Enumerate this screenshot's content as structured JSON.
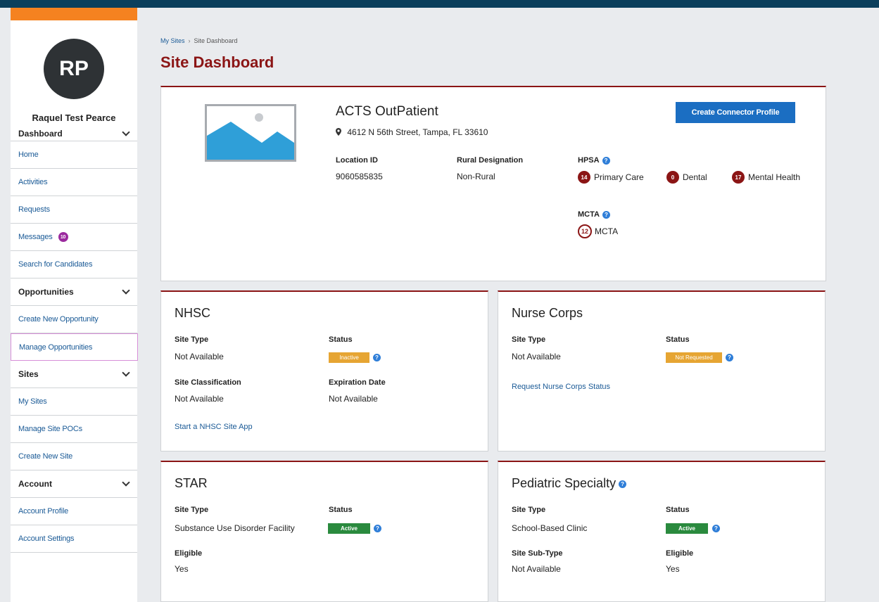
{
  "user": {
    "initials": "RP",
    "name": "Raquel Test Pearce"
  },
  "nav": {
    "dashboard": {
      "label": "Dashboard",
      "items": [
        "Home",
        "Activities",
        "Requests",
        "Messages",
        "Search for Candidates"
      ],
      "messages_count": "10"
    },
    "opportunities": {
      "label": "Opportunities",
      "items": [
        "Create New Opportunity",
        "Manage Opportunities"
      ]
    },
    "sites": {
      "label": "Sites",
      "items": [
        "My Sites",
        "Manage Site POCs",
        "Create New Site"
      ]
    },
    "account": {
      "label": "Account",
      "items": [
        "Account Profile",
        "Account Settings"
      ]
    }
  },
  "breadcrumb": {
    "parent": "My Sites",
    "separator": "›",
    "current": "Site Dashboard"
  },
  "page_title": "Site Dashboard",
  "site": {
    "name": "ACTS OutPatient",
    "address": "4612 N 56th Street, Tampa, FL 33610",
    "create_button": "Create Connector Profile",
    "location_id_label": "Location ID",
    "location_id": "9060585835",
    "rural_label": "Rural Designation",
    "rural_value": "Non-Rural",
    "hpsa_label": "HPSA",
    "hpsa": [
      {
        "count": "14",
        "label": "Primary Care"
      },
      {
        "count": "0",
        "label": "Dental"
      },
      {
        "count": "17",
        "label": "Mental Health"
      }
    ],
    "mcta_label": "MCTA",
    "mcta_count": "12",
    "mcta_text": "MCTA"
  },
  "nhsc": {
    "title": "NHSC",
    "site_type_label": "Site Type",
    "site_type": "Not Available",
    "status_label": "Status",
    "status": "Inactive",
    "classification_label": "Site Classification",
    "classification": "Not Available",
    "expiration_label": "Expiration Date",
    "expiration": "Not Available",
    "link": "Start a NHSC Site App"
  },
  "nurse": {
    "title": "Nurse Corps",
    "site_type_label": "Site Type",
    "site_type": "Not Available",
    "status_label": "Status",
    "status": "Not Requested",
    "link": "Request Nurse Corps Status"
  },
  "star": {
    "title": "STAR",
    "site_type_label": "Site Type",
    "site_type": "Substance Use Disorder Facility",
    "status_label": "Status",
    "status": "Active",
    "eligible_label": "Eligible",
    "eligible": "Yes"
  },
  "pediatric": {
    "title": "Pediatric Specialty",
    "site_type_label": "Site Type",
    "site_type": "School-Based Clinic",
    "status_label": "Status",
    "status": "Active",
    "subtype_label": "Site Sub-Type",
    "subtype": "Not Available",
    "eligible_label": "Eligible",
    "eligible": "Yes"
  },
  "colors": {
    "brand_red": "#8b1515",
    "accent_orange": "#f58220",
    "header_navy": "#0b3f5c",
    "link_blue": "#1a5a96",
    "button_blue": "#1b6ec2",
    "active_green": "#2a8a3e",
    "inactive_amber": "#e6a533"
  },
  "icons": {
    "info": "info-icon",
    "location": "map-pin-icon",
    "placeholder": "image-placeholder-icon",
    "chevron": "chevron-down-icon"
  }
}
